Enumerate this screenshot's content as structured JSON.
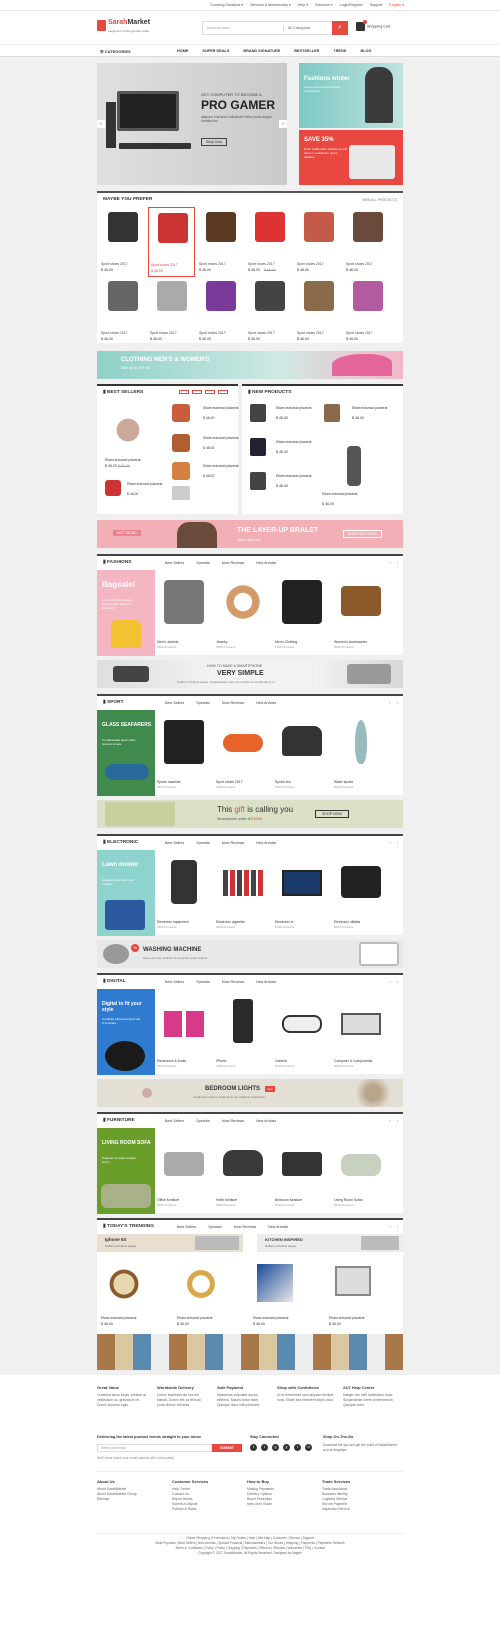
{
  "topbar": {
    "links": [
      "Sourcing Solutions ▾",
      "Services & Membership ▾",
      "Help ▾",
      "Solutions ▾",
      "Login/Register",
      "Support"
    ],
    "language": "English ▾"
  },
  "header": {
    "logo_main": "Sarah",
    "logo_accent": "Market",
    "tagline": "Large form of the grocery store",
    "search_placeholder": "Keyword here...",
    "search_category": "All Categories",
    "cart_label": "Shopping Cart"
  },
  "nav": {
    "categories_label": "CATEGORIES",
    "items": [
      "HOME",
      "SUPER DEALS",
      "BRAND SIGNATURE",
      "BESTSELLER",
      "TREND",
      "BLOG"
    ]
  },
  "hero": {
    "tagline": "GET COMPUTER TO BECOME A",
    "headline": "PRO GAMER",
    "text": "aliquam erat arcu sollicitudin tellus porta augue. Vestibulum",
    "button": "Shop Now",
    "prev": "‹",
    "next": "›"
  },
  "promo_side": {
    "top_title": "Fashions winter",
    "top_text": "Lorem ipsum dolor sit amet, consectetur",
    "bottom_title": "SAVE 35%",
    "bottom_text": "Proin mollis dolor. Mauris at velit dolor in vestibulum quam tristique"
  },
  "maybe_you_prefer": {
    "title": "MAYBE YOU PREFER",
    "view_all": "VIEW ALL PRODUCTS",
    "products": [
      {
        "name": "Sport shoes 2017",
        "price": "$ 46.00",
        "old": ""
      },
      {
        "name": "Sport shoes 2017",
        "price": "$ 46.00",
        "old": ""
      },
      {
        "name": "Sport shoes 2017",
        "price": "$ 46.00",
        "old": ""
      },
      {
        "name": "Sport shoes 2017",
        "price": "$ 46.00",
        "old": "$ 60.00"
      },
      {
        "name": "Sport shoes 2017",
        "price": "$ 46.00",
        "old": ""
      },
      {
        "name": "Sport shoes 2017",
        "price": "$ 46.00",
        "old": ""
      },
      {
        "name": "Sport shoes 2017",
        "price": "$ 46.00",
        "old": ""
      },
      {
        "name": "Sport shoes 2017",
        "price": "$ 46.00",
        "old": ""
      },
      {
        "name": "Sport shoes 2017",
        "price": "$ 46.00",
        "old": ""
      },
      {
        "name": "Sport shoes 2017",
        "price": "$ 46.00",
        "old": ""
      },
      {
        "name": "Sport shoes 2017",
        "price": "$ 46.00",
        "old": ""
      },
      {
        "name": "Sport shoes 2017",
        "price": "$ 46.00",
        "old": ""
      }
    ]
  },
  "banner_clothing": {
    "title": "CLOTHING MEN'S & WOMEN'S",
    "sub": "Sale up to 70% off"
  },
  "best_sellers": {
    "title": "BEST SELLERS",
    "items": [
      {
        "name": "Etiam euismod placerat",
        "price": "$ 46.00"
      },
      {
        "name": "Etiam euismod placerat",
        "price": "$ 46.00"
      },
      {
        "name": "Etiam euismod placerat",
        "price": "$ 46.00"
      },
      {
        "name": "Etiam euismod placerat",
        "price": "$ 46.00"
      },
      {
        "name": "Etiam euismod placerat",
        "price": "$ 46.00",
        "old": "$ 60.00"
      }
    ]
  },
  "new_products": {
    "title": "NEW PRODUCTS",
    "items": [
      {
        "name": "Etiam euismod placerat",
        "price": "$ 46.00"
      },
      {
        "name": "Etiam euismod placerat",
        "price": "$ 46.00"
      },
      {
        "name": "Etiam euismod placerat",
        "price": "$ 46.00"
      },
      {
        "name": "Etiam euismod placerat",
        "price": "$ 46.00"
      },
      {
        "name": "Etiam euismod placerat",
        "price": "$ 46.00"
      },
      {
        "name": "Etiam euismod placerat",
        "price": "$ 46.00"
      }
    ]
  },
  "banner_layer": {
    "hot": "HOT TREND",
    "title": "THE LAYER-UP BRALET",
    "sub": "Over and out",
    "button": "SHOP HOT ITEMS"
  },
  "tabs": [
    "Best Sellers",
    "Specials",
    "Most Reviews",
    "New Arrivals"
  ],
  "fashions": {
    "title": "FASHIONS",
    "left_title": "Bagsale!",
    "left_text": "Lorem et finibus augue. Suspendisse erat orci, ultricies at",
    "items": [
      {
        "name": "Men's Jackets",
        "count": "3562 Products"
      },
      {
        "name": "Jewelry",
        "count": "4636 Products"
      },
      {
        "name": "Men's Clothing",
        "count": "5790 Products"
      },
      {
        "name": "Women's Accessories",
        "count": "8542 Products"
      }
    ]
  },
  "banner_phone": {
    "small": "HOW TO MAKE A SMARTPHONE",
    "big": "VERY SIMPLE",
    "sub": "Nullam et finibus augue. Suspendisse erat orci, ultricies at et bibendum et."
  },
  "sport": {
    "title": "SPORT",
    "left_title": "GLASS SEAFARERS",
    "left_text": "In malesuada quam dolor tempus ornare",
    "items": [
      {
        "name": "Sports machine",
        "count": "3562 Products"
      },
      {
        "name": "Sport shoes 2017",
        "count": "4636 Products"
      },
      {
        "name": "Sports bra",
        "count": "5790 Products"
      },
      {
        "name": "Water sports",
        "count": "8542 Products"
      }
    ]
  },
  "banner_gift": {
    "title_pre": "This ",
    "title_em": "gift",
    "title_post": " is calling you",
    "sub_pre": "Smartphone under US ",
    "sub_price": "$299",
    "button": "SHOP NOW"
  },
  "electronic": {
    "title": "ELECTRONIC",
    "left_title": "Lawn mower",
    "left_text": "Aliquam etiam diam sed sodales",
    "items": [
      {
        "name": "Electronic equipment",
        "count": "3562 Products"
      },
      {
        "name": "Electronic cigarette",
        "count": "4636 Products"
      },
      {
        "name": "Electronic tv",
        "count": "5790 Products"
      },
      {
        "name": "Electronic utilities",
        "count": "8542 Products"
      }
    ]
  },
  "banner_wash": {
    "badge": "%",
    "title": "WASHING MACHINE",
    "sub": "Nam erat orci, ultricies at imperdiet quam finibus."
  },
  "digital": {
    "title": "DIGITAL",
    "left_title": "Digital to fit your style",
    "left_text": "Curabitur ultrices tempus elit in a ornare",
    "items": [
      {
        "name": "Electronics & Audio",
        "count": "3562 Products"
      },
      {
        "name": "iPhone",
        "count": "4636 Products"
      },
      {
        "name": "Camera",
        "count": "5790 Products"
      },
      {
        "name": "Computer & Components",
        "count": "8542 Products"
      }
    ]
  },
  "banner_lights": {
    "title": "BEDROOM LIGHTS",
    "badge": "new",
    "sub": "Vestibulum ultrices nulla lacus nec dapibus vestibulum."
  },
  "furniture": {
    "title": "FURNITURE",
    "left_title": "LIVING ROOM SOFA",
    "left_text": "Praesent et quam feugiat lorem",
    "items": [
      {
        "name": "Office furniture",
        "count": "3562 Products"
      },
      {
        "name": "Hotel furniture",
        "count": "4636 Products"
      },
      {
        "name": "Bedroom furniture",
        "count": "5790 Products"
      },
      {
        "name": "Living Room Sofas",
        "count": "8542 Products"
      }
    ]
  },
  "trending": {
    "title": "TODAY'S TRENDING",
    "promo_left_title": "Iphone 6S",
    "promo_left_sub": "Nullam et finibus augue.",
    "promo_right_title": "KITCHEN INSPIRED",
    "promo_right_sub": "Nullam et finibus augue.",
    "items": [
      {
        "name": "Etiam euismod placerat",
        "price": "$ 46.00"
      },
      {
        "name": "Etiam euismod placerat",
        "price": "$ 46.00"
      },
      {
        "name": "Etiam euismod placerat",
        "price": "$ 46.00"
      },
      {
        "name": "Etiam euismod placerat",
        "price": "$ 46.00"
      }
    ]
  },
  "footer": {
    "features": [
      {
        "h": "Great Value",
        "t": "Curabitur lacus turpis, pretium at vestibulum ac, gravida et mi. Donec at purus eget"
      },
      {
        "h": "Worldwide Delivery",
        "t": "Donec imperdiet dui nec elit blandit. Donec elit, ac felis ac porta dictum vehicula"
      },
      {
        "h": "Safe Payment",
        "t": "Maecenas vulputate auctor, eleifend. Mauris tortor diam, Quisque dolor nibh pharetra"
      },
      {
        "h": "Shop with Confidence",
        "t": "Ut et fermentum sem aliquam facilisis nunc. Etiam sed hendrerit turpis dolor"
      },
      {
        "h": "24/7 Help Center",
        "t": "Integer nec velit vestibulum dolor. Suspendisse lorem ut fermentum. Quisque dolor"
      }
    ],
    "newsletter_title": "Delivering the latest product trends straight to your inbox",
    "newsletter_placeholder": "Enter your email",
    "newsletter_button": "SUBMIT",
    "newsletter_note": "We'll never share your email address with a third-party.",
    "stay_connected": "Stay Connected",
    "social": [
      "f",
      "t",
      "g",
      "y",
      "i",
      "d"
    ],
    "on_the_go_title": "Shop On-The-Go",
    "on_the_go_text": "Download the app and get the world of SarahMarket at your fingertips",
    "cols": [
      {
        "h": "About Us",
        "items": [
          "About SarahMarket",
          "About SarahMarket Group",
          "Sitemap"
        ]
      },
      {
        "h": "Customer Services",
        "items": [
          "Help Center",
          "Contact Us",
          "Report Abuse",
          "Submit a Dispute",
          "Policies & Rules"
        ]
      },
      {
        "h": "How to Buy",
        "items": [
          "Making Payments",
          "Delivery Options",
          "Buyer Protection",
          "New User Guide"
        ]
      },
      {
        "h": "Trade Services",
        "items": [
          "Trade Assurance",
          "Business Identity",
          "Logistics Service",
          "Secure Payment",
          "Inspection Service"
        ]
      }
    ],
    "links1": "Online Shopping | Promotions | My Orders | Help | Site Map | Customer | Service | Support",
    "links2": "Most Populars | Best Sellers | New Arrivals | Special Products | Manufacturers | Our Stores | Shipping | Payments | Payments Refunds",
    "links3": "Terms & Conditions | Policy | Policy | Shipping | Payments | Returns | Refunds | Warrantee | FAQ | Contact",
    "copyright": "Copyright © 2017 SarahMarket. All Rights Reserved. Designed by Magen"
  }
}
